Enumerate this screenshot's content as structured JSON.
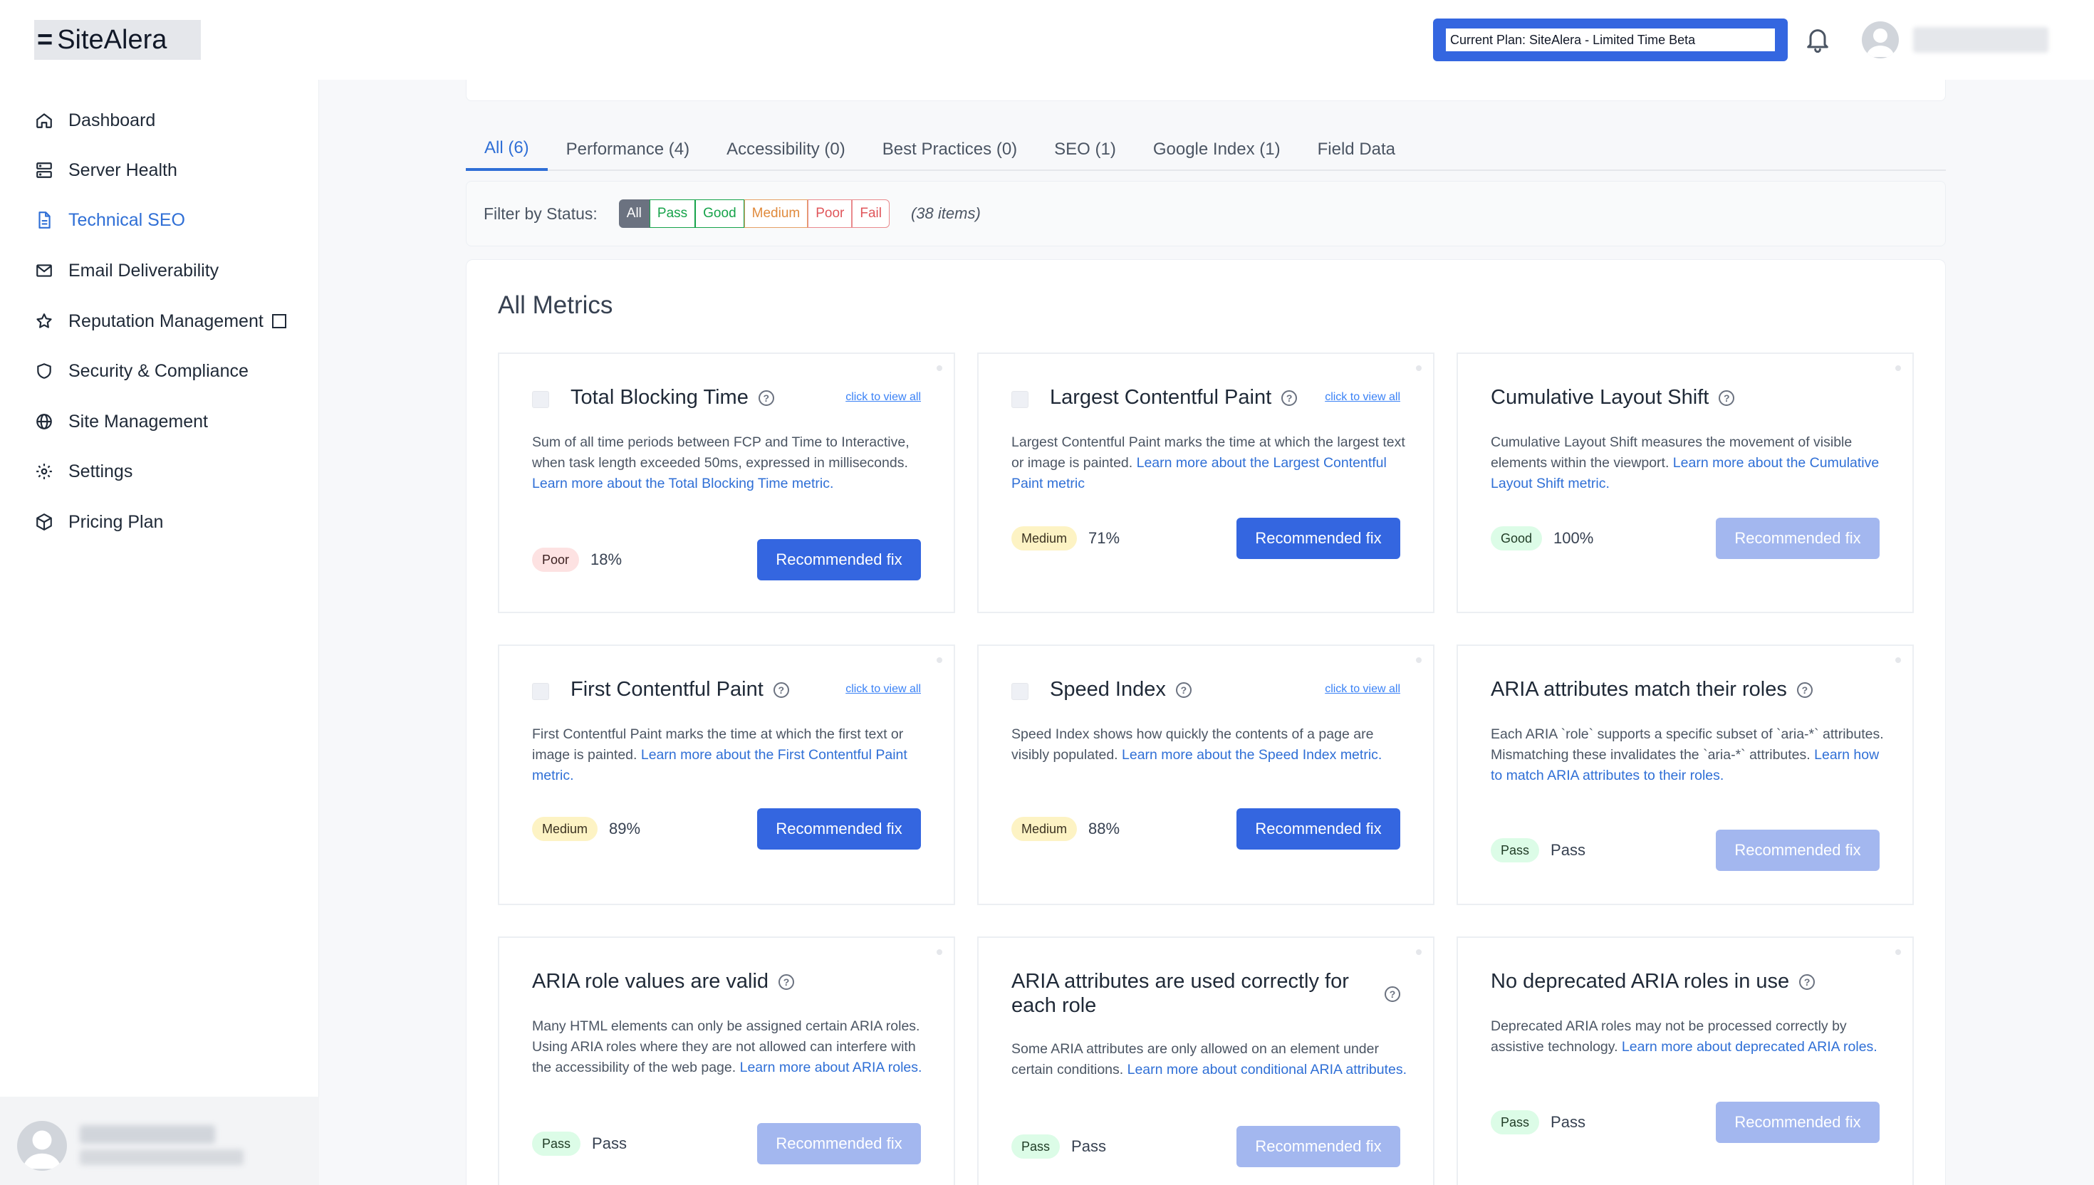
{
  "app": {
    "name": "SiteAlera",
    "menu_icon": "="
  },
  "header": {
    "plan_label": "Current Plan: SiteAlera - Limited Time Beta",
    "bell_icon": "bell-icon",
    "avatar_icon": "user-avatar-icon"
  },
  "sidebar": {
    "items": [
      {
        "label": "Dashboard",
        "icon": "home-icon",
        "active": false
      },
      {
        "label": "Server Health",
        "icon": "server-icon",
        "active": false
      },
      {
        "label": "Technical SEO",
        "icon": "document-icon",
        "active": true
      },
      {
        "label": "Email Deliverability",
        "icon": "mail-icon",
        "active": false
      },
      {
        "label": "Reputation Management",
        "icon": "star-icon",
        "active": false
      },
      {
        "label": "Security & Compliance",
        "icon": "shield-icon",
        "active": false
      },
      {
        "label": "Site Management",
        "icon": "globe-icon",
        "active": false
      },
      {
        "label": "Settings",
        "icon": "gear-icon",
        "active": false
      },
      {
        "label": "Pricing Plan",
        "icon": "package-icon",
        "active": false
      }
    ]
  },
  "tabs": [
    {
      "label": "All (6)",
      "active": true
    },
    {
      "label": "Performance (4)",
      "active": false
    },
    {
      "label": "Accessibility (0)",
      "active": false
    },
    {
      "label": "Best Practices (0)",
      "active": false
    },
    {
      "label": "SEO (1)",
      "active": false
    },
    {
      "label": "Google Index (1)",
      "active": false
    },
    {
      "label": "Field Data",
      "active": false
    }
  ],
  "filter": {
    "label": "Filter by Status:",
    "chips": [
      "All",
      "Pass",
      "Good",
      "Medium",
      "Poor",
      "Fail"
    ],
    "selected": "All",
    "count": "(38 items)"
  },
  "metrics": {
    "title": "All Metrics",
    "view_all_label": "click to view all",
    "fix_label": "Recommended fix",
    "cards": [
      {
        "title": "Total Blocking Time",
        "desc": "Sum of all time periods between FCP and Time to Interactive, when task length exceeded 50ms, expressed in milliseconds. ",
        "link": "Learn more about the Total Blocking Time metric.",
        "badge": "Poor",
        "value": "18%",
        "checkbox": true,
        "view_all": true,
        "fix_enabled": true
      },
      {
        "title": "Largest Contentful Paint",
        "desc": "Largest Contentful Paint marks the time at which the largest text or image is painted. ",
        "link": "Learn more about the Largest Contentful Paint metric",
        "badge": "Medium",
        "value": "71%",
        "checkbox": true,
        "view_all": true,
        "fix_enabled": true
      },
      {
        "title": "Cumulative Layout Shift",
        "desc": "Cumulative Layout Shift measures the movement of visible elements within the viewport. ",
        "link": "Learn more about the Cumulative Layout Shift metric.",
        "badge": "Good",
        "value": "100%",
        "checkbox": false,
        "view_all": false,
        "fix_enabled": false
      },
      {
        "title": "First Contentful Paint",
        "desc": "First Contentful Paint marks the time at which the first text or image is painted. ",
        "link": "Learn more about the First Contentful Paint metric.",
        "badge": "Medium",
        "value": "89%",
        "checkbox": true,
        "view_all": true,
        "fix_enabled": true
      },
      {
        "title": "Speed Index",
        "desc": "Speed Index shows how quickly the contents of a page are visibly populated. ",
        "link": "Learn more about the Speed Index metric.",
        "badge": "Medium",
        "value": "88%",
        "checkbox": true,
        "view_all": true,
        "fix_enabled": true
      },
      {
        "title": "ARIA attributes match their roles",
        "desc": "Each ARIA `role` supports a specific subset of `aria-*` attributes. Mismatching these invalidates the `aria-*` attributes. ",
        "link": "Learn how to match ARIA attributes to their roles.",
        "badge": "Pass",
        "value": "Pass",
        "checkbox": false,
        "view_all": false,
        "fix_enabled": false
      },
      {
        "title": "ARIA role values are valid",
        "desc": "Many HTML elements can only be assigned certain ARIA roles. Using ARIA roles where they are not allowed can interfere with the accessibility of the web page. ",
        "link": "Learn more about ARIA roles.",
        "badge": "Pass",
        "value": "Pass",
        "checkbox": false,
        "view_all": false,
        "fix_enabled": false
      },
      {
        "title": "ARIA attributes are used correctly for each role",
        "desc": "Some ARIA attributes are only allowed on an element under certain conditions. ",
        "link": "Learn more about conditional ARIA attributes.",
        "badge": "Pass",
        "value": "Pass",
        "checkbox": false,
        "view_all": false,
        "fix_enabled": false
      },
      {
        "title": "No deprecated ARIA roles in use",
        "desc": "Deprecated ARIA roles may not be processed correctly by assistive technology. ",
        "link": "Learn more about deprecated ARIA roles.",
        "badge": "Pass",
        "value": "Pass",
        "checkbox": false,
        "view_all": false,
        "fix_enabled": false
      }
    ]
  }
}
